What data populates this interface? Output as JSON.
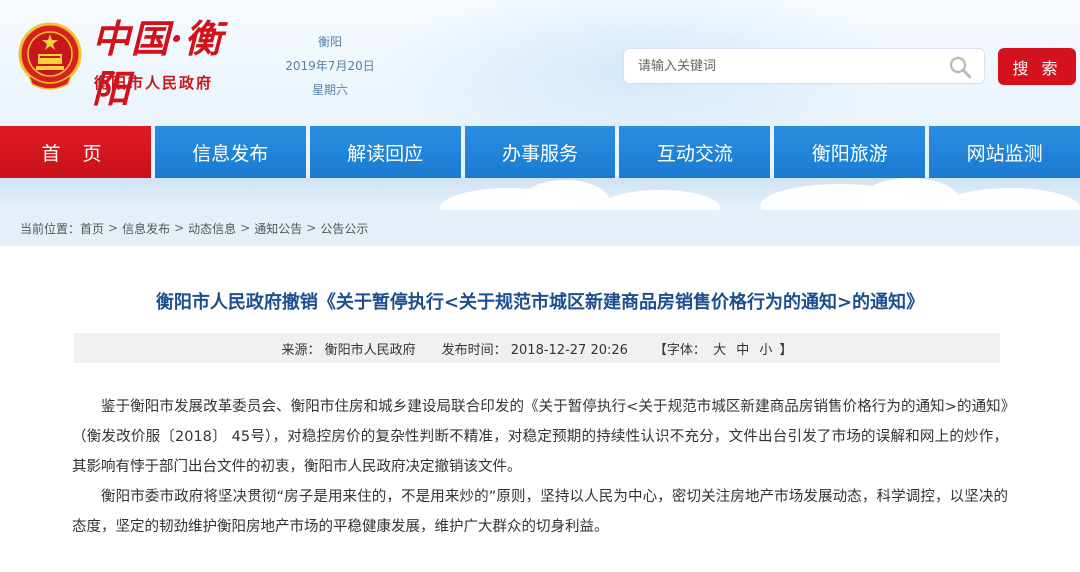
{
  "header": {
    "logo_title": "中国·衡阳",
    "logo_subtitle": "衡阳市人民政府",
    "city": "衡阳",
    "date": "2019年7月20日",
    "weekday": "星期六",
    "search_placeholder": "请输入关键词",
    "search_button": "搜 索"
  },
  "nav": {
    "items": [
      {
        "label": "首 页",
        "active": true
      },
      {
        "label": "信息发布"
      },
      {
        "label": "解读回应"
      },
      {
        "label": "办事服务"
      },
      {
        "label": "互动交流"
      },
      {
        "label": "衡阳旅游"
      },
      {
        "label": "网站监测"
      }
    ]
  },
  "breadcrumb": {
    "prefix": "当前位置：",
    "items": [
      "首页",
      "信息发布",
      "动态信息",
      "通知公告",
      "公告公示"
    ]
  },
  "article": {
    "title": "衡阳市人民政府撤销《关于暂停执行<关于规范市城区新建商品房销售价格行为的通知>的通知》",
    "source_label": "来源：",
    "source": "衡阳市人民政府",
    "time_label": "发布时间：",
    "time": "2018-12-27 20:26",
    "font_label": "【字体：",
    "font_sizes": [
      "大",
      "中",
      "小"
    ],
    "font_close": "】",
    "paragraphs": [
      "鉴于衡阳市发展改革委员会、衡阳市住房和城乡建设局联合印发的《关于暂停执行<关于规范市城区新建商品房销售价格行为的通知>的通知》（衡发改价服〔2018〕 45号），对稳控房价的复杂性判断不精准，对稳定预期的持续性认识不充分，文件出台引发了市场的误解和网上的炒作，其影响有悖于部门出台文件的初衷，衡阳市人民政府决定撤销该文件。",
      "衡阳市委市政府将坚决贯彻“房子是用来住的，不是用来炒的”原则，坚持以人民为中心，密切关注房地产市场发展动态，科学调控，以坚决的态度，坚定的韧劲维护衡阳房地产市场的平稳健康发展，维护广大群众的切身利益。"
    ]
  },
  "colors": {
    "brand_red": "#d4121d",
    "nav_blue": "#1a7bd0",
    "title_blue": "#1d4e8f"
  }
}
